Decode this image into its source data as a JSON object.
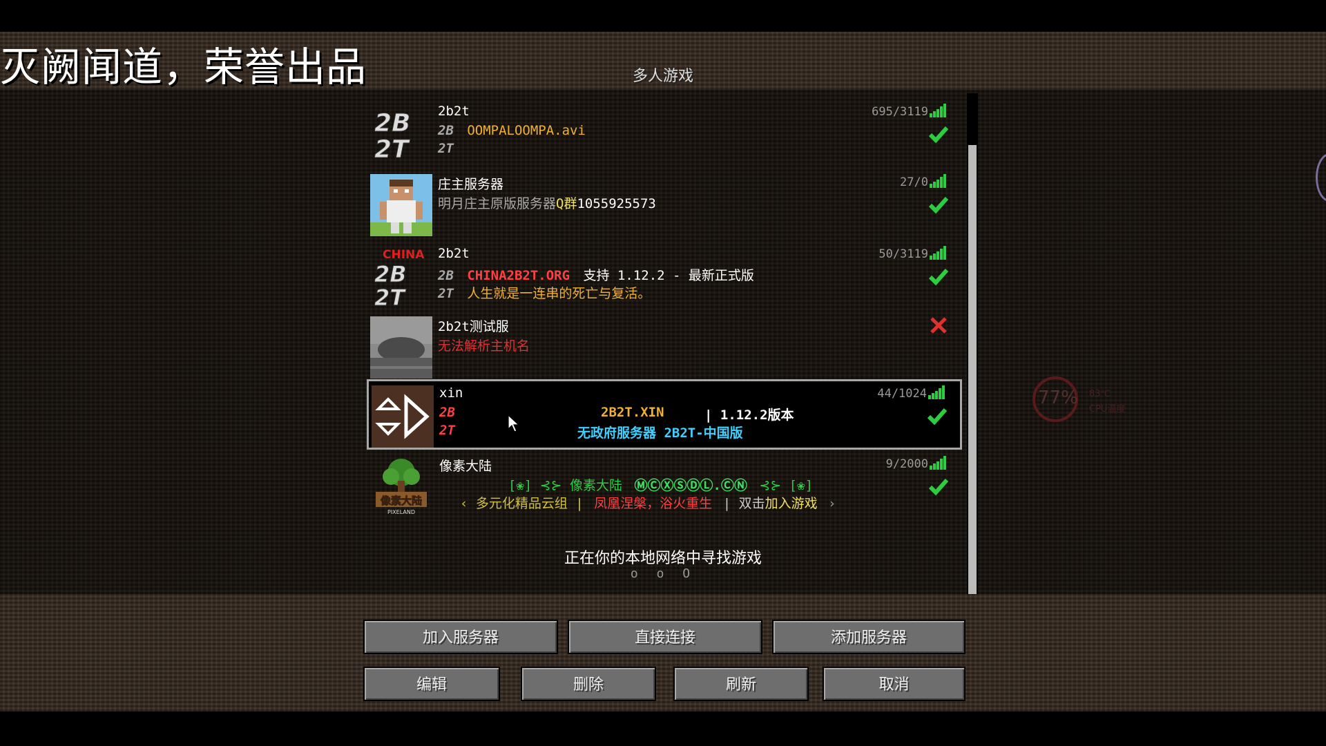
{
  "watermark": "灭阙闻道，荣誉出品",
  "screen_title": "多人游戏",
  "servers": [
    {
      "name": "2b2t",
      "count": "695/3119",
      "motd1_prefix": "2B",
      "motd1": "OOMPALOOMPA.avi",
      "motd2_prefix": "2T",
      "motd2": "",
      "status": "online"
    },
    {
      "name": "庄主服务器",
      "count": "27/0",
      "motd1_prefix": "",
      "motd1": "明月庄主原版服务器",
      "motd1_b": "Q群",
      "motd1_c": "1055925573",
      "status": "online"
    },
    {
      "name": "2b2t",
      "count": "50/3119",
      "motd1_prefix": "2B",
      "motd1": "CHINA2B2T.ORG",
      "motd1_b": "支持 1.12.2 - 最新正式版",
      "motd2_prefix": "2T",
      "motd2": "人生就是一连串的死亡与复活。",
      "icon_label": "CHINA",
      "status": "online"
    },
    {
      "name": "2b2t测试服",
      "count": "",
      "motd1": "无法解析主机名",
      "status": "error"
    },
    {
      "name": "xin",
      "count": "44/1024",
      "motd1_prefix": "2B",
      "motd1": "2B2T.XIN",
      "motd1_b": "| 1.12.2版本",
      "motd2_prefix": "2T",
      "motd2": "无政府服务器 2B2T-中国版",
      "status": "online",
      "selected": true
    },
    {
      "name": "像素大陆",
      "count": "9/2000",
      "motd1": "[❀] ⊰⊱ 像素大陆",
      "motd1_b": "ⓂⒸⓍⓈⒹⓁ.ⒸⓃ",
      "motd1_c": "⊰⊱ [❀]",
      "motd2_a": "‹ 多元化精品云组 |",
      "motd2_b": "凤凰涅槃，浴火重生",
      "motd2_c": "| 双击",
      "motd2_d": "加入游戏",
      "motd2_e": "›",
      "icon_label": "像素大陆",
      "icon_sub": "PIXELAND",
      "status": "online"
    }
  ],
  "scanning": "正在你的本地网络中寻找游戏",
  "scanning_dots": "o o O",
  "buttons": {
    "join": "加入服务器",
    "direct": "直接连接",
    "add": "添加服务器",
    "edit": "编辑",
    "delete": "删除",
    "refresh": "刷新",
    "cancel": "取消"
  },
  "overlay": {
    "cpu_percent": "77%",
    "cpu_temp": "83℃",
    "cpu_label": "CPU温度"
  },
  "colors": {
    "online": "#2ecc40",
    "error": "#e03030",
    "gold": "#f0b030",
    "red": "#ff4040",
    "aqua": "#40d0ff"
  }
}
